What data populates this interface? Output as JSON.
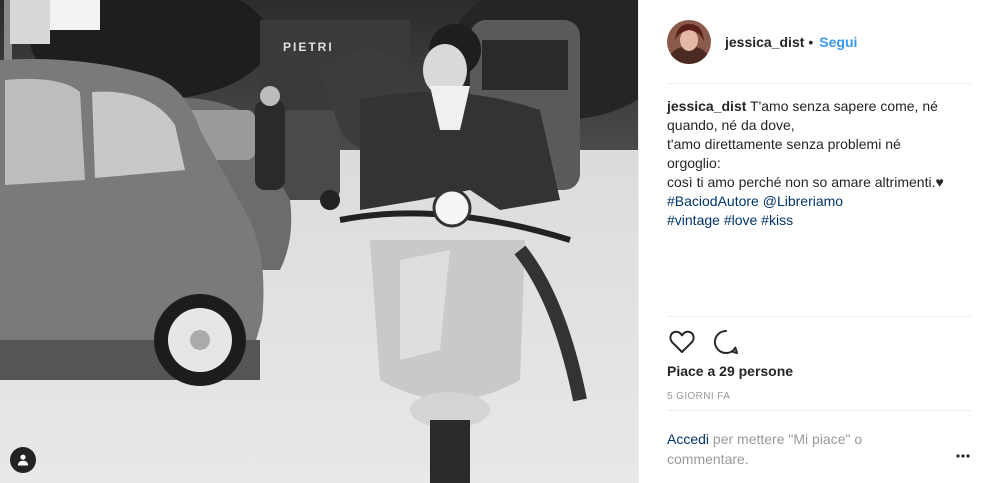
{
  "post": {
    "author": "jessica_dist",
    "follow_label": "Segui",
    "separator": "•",
    "image_alt": "Vintage black and white photo of a couple kissing on a scooter",
    "storefront_sign": "PIETRI"
  },
  "caption": {
    "username": "jessica_dist",
    "lines": [
      "T'amo senza sapere come, né",
      "quando, né da dove,",
      "t'amo direttamente senza problemi né",
      "orgoglio:",
      "così ti amo perché non so amare altrimenti.",
      "#BaciodAutore @Libreriamo",
      "#vintage #love #kiss"
    ],
    "heart_emoji": "♥"
  },
  "actions": {
    "like_icon": "heart-outline-icon",
    "comment_icon": "speech-bubble-icon",
    "likes_text": "Piace a 29 persone",
    "time_ago": "5 GIORNI FA"
  },
  "comment": {
    "login_link": "Accedi",
    "prompt": " per mettere \"Mi piace\" o commentare.",
    "more_icon": "ellipsis-icon"
  }
}
